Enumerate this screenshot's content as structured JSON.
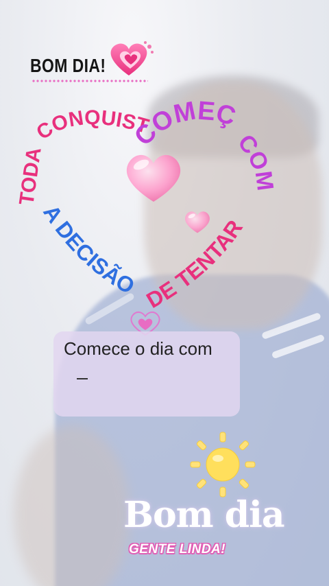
{
  "top_label": "BOM DIA!",
  "quote": {
    "line1": "TODA",
    "line2": "CONQUISTA",
    "line3": "COMEÇA",
    "line4": "COM",
    "line5": "A DECISÃO",
    "line6": "DE TENTAR"
  },
  "text_card": {
    "value": "Comece o dia com"
  },
  "bottom": {
    "title": "Bom dia",
    "subtitle": "GENTE LINDA!"
  },
  "colors": {
    "pink": "#e8307d",
    "magenta": "#c040d8",
    "blue": "#2f6fe0",
    "label": "#151515"
  },
  "icons": [
    "hearts-sticker-icon",
    "glossy-heart-icon",
    "outline-heart-icon",
    "sun-icon"
  ]
}
